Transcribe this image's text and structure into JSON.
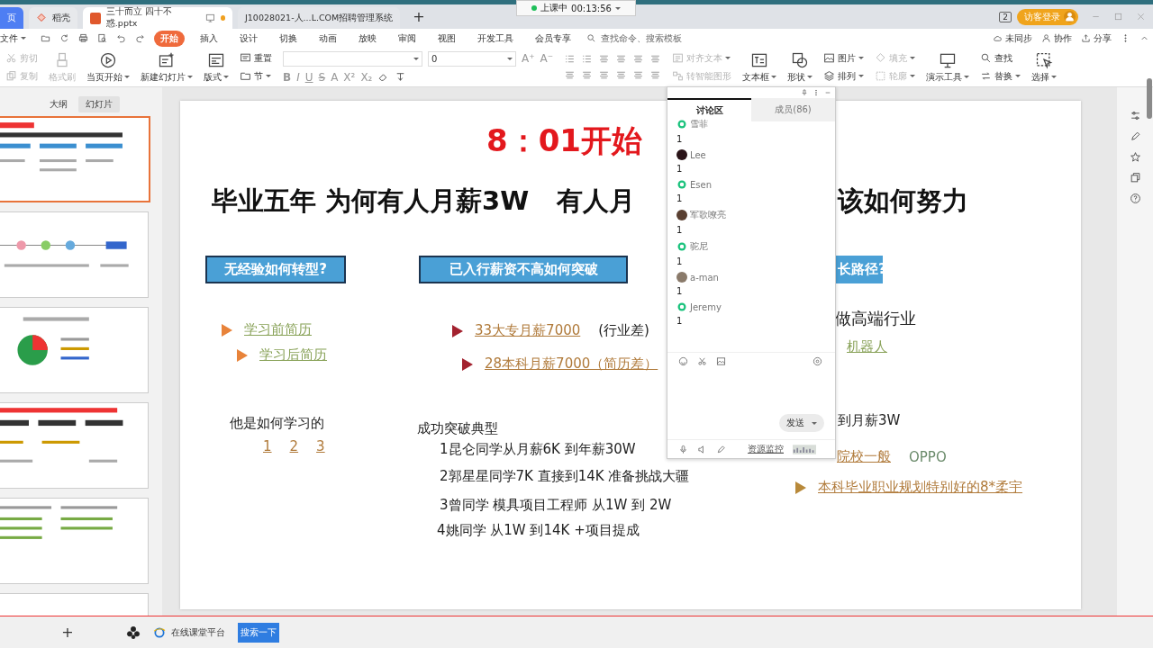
{
  "recording_widget": {
    "status": "上课中",
    "time": "00:13:56"
  },
  "tabs": [
    {
      "label": "页",
      "kind": "home",
      "selected": false
    },
    {
      "label": "稻壳",
      "kind": "docer",
      "selected": false
    },
    {
      "label": "三十而立 四十不惑.pptx",
      "kind": "pptx",
      "selected": true,
      "unsaved": true
    },
    {
      "label": "J10028021-人...L.COM招聘管理系统",
      "kind": "web",
      "selected": false
    }
  ],
  "new_tab": "+",
  "account": {
    "badge": "2",
    "login": "访客登录"
  },
  "menu": {
    "file": "文件",
    "items": [
      {
        "label": "开始",
        "selected": true
      },
      {
        "label": "插入",
        "selected": false
      },
      {
        "label": "设计",
        "selected": false
      },
      {
        "label": "切换",
        "selected": false
      },
      {
        "label": "动画",
        "selected": false
      },
      {
        "label": "放映",
        "selected": false
      },
      {
        "label": "审阅",
        "selected": false
      },
      {
        "label": "视图",
        "selected": false
      },
      {
        "label": "开发工具",
        "selected": false
      },
      {
        "label": "会员专享",
        "selected": false
      }
    ],
    "search": {
      "placeholder": "查找命令、搜索模板"
    },
    "right": [
      "未同步",
      "协作",
      "分享"
    ]
  },
  "ribbon": [
    {
      "kind": "stack",
      "items": [
        {
          "label": "剪切",
          "disabled": true,
          "dropdown": false
        },
        {
          "label": "复制",
          "disabled": true,
          "dropdown": false
        }
      ]
    },
    {
      "kind": "large",
      "label": "格式刷",
      "disabled": true,
      "dropdown": false
    },
    {
      "kind": "large",
      "label": "当页开始",
      "disabled": false,
      "dropdown": true
    },
    {
      "kind": "large",
      "label": "新建幻灯片",
      "disabled": false,
      "dropdown": true
    },
    {
      "kind": "large",
      "label": "版式",
      "disabled": false,
      "dropdown": true
    },
    {
      "kind": "stack",
      "items": [
        {
          "label": "重置",
          "disabled": false,
          "dropdown": false
        },
        {
          "label": "节",
          "disabled": false,
          "dropdown": true
        }
      ]
    },
    {
      "kind": "font",
      "size": "0",
      "row1": [
        "A⁺",
        "A⁻"
      ],
      "row2": [
        "B",
        "I",
        "U",
        "S",
        "A",
        "X²",
        "X₂"
      ]
    },
    {
      "kind": "paragraph"
    },
    {
      "kind": "stack",
      "items": [
        {
          "label": "对齐文本",
          "disabled": true,
          "dropdown": true
        },
        {
          "label": "转智能图形",
          "disabled": true,
          "dropdown": false
        }
      ]
    },
    {
      "kind": "large",
      "label": "文本框",
      "disabled": false,
      "dropdown": true
    },
    {
      "kind": "large",
      "label": "形状",
      "disabled": false,
      "dropdown": true
    },
    {
      "kind": "stack",
      "items": [
        {
          "label": "图片",
          "disabled": false,
          "dropdown": true
        },
        {
          "label": "排列",
          "disabled": false,
          "dropdown": true
        }
      ]
    },
    {
      "kind": "stack",
      "items": [
        {
          "label": "填充",
          "disabled": true,
          "dropdown": true
        },
        {
          "label": "轮廓",
          "disabled": true,
          "dropdown": true
        }
      ]
    },
    {
      "kind": "large",
      "label": "演示工具",
      "disabled": false,
      "dropdown": true
    },
    {
      "kind": "stack",
      "items": [
        {
          "label": "查找",
          "disabled": false,
          "dropdown": false
        },
        {
          "label": "替换",
          "disabled": false,
          "dropdown": true
        }
      ]
    },
    {
      "kind": "large",
      "label": "选择",
      "disabled": false,
      "dropdown": true
    }
  ],
  "side_panel": {
    "tabs": [
      {
        "label": "大纲",
        "selected": false
      },
      {
        "label": "幻灯片",
        "selected": true
      }
    ],
    "thumbnails": [
      {
        "selected": true
      },
      {
        "selected": false
      },
      {
        "selected": false
      },
      {
        "selected": false
      },
      {
        "selected": false
      },
      {
        "selected": false
      }
    ],
    "add": "+"
  },
  "slide": {
    "heading": "8：01开始",
    "title_parts": [
      "毕业五年 为何有人月薪3W   有人月",
      "该如何努力"
    ],
    "boxes": [
      "无经验如何转型?",
      "已入行薪资不高如何突破",
      "长路径?"
    ],
    "lines": [
      {
        "bullet": {
          "color": "#e8833a"
        },
        "spans": [
          {
            "kind": "link",
            "text": "学习前简历",
            "color": "#8aa35a"
          }
        ]
      },
      {
        "bullet": {
          "color": "#e8833a"
        },
        "spans": [
          {
            "kind": "link",
            "text": "学习后简历",
            "color": "#8aa35a"
          }
        ]
      },
      {
        "spans": [
          {
            "kind": "text",
            "text": "他是如何学习的"
          }
        ]
      },
      {
        "spans": [
          {
            "kind": "link",
            "text": "1",
            "color": "#b07a3a"
          },
          {
            "kind": "link",
            "text": "2",
            "color": "#b07a3a"
          },
          {
            "kind": "link",
            "text": "3",
            "color": "#b07a3a"
          }
        ]
      },
      {
        "bullet": {
          "color": "#a3222f"
        },
        "spans": [
          {
            "kind": "link",
            "text": "33大专月薪7000",
            "color": "#b07a3a"
          },
          {
            "kind": "text",
            "text": "(行业差)"
          }
        ]
      },
      {
        "bullet": {
          "color": "#a3222f"
        },
        "spans": [
          {
            "kind": "link",
            "text": "28本科月薪7000（简历差）",
            "color": "#b07a3a"
          }
        ]
      },
      {
        "spans": [
          {
            "kind": "text",
            "text": "成功突破典型"
          }
        ]
      },
      {
        "spans": [
          {
            "kind": "text",
            "text": "1昆仑同学从月薪6K  到年薪30W"
          }
        ]
      },
      {
        "spans": [
          {
            "kind": "text",
            "text": "2郭星星同学7K 直接到14K 准备挑战大疆"
          }
        ]
      },
      {
        "spans": [
          {
            "kind": "text",
            "text": "3曾同学 模具项目工程师  从1W 到 2W"
          }
        ]
      },
      {
        "spans": [
          {
            "kind": "text",
            "text": "4姚同学 从1W 到14K +项目提成"
          }
        ]
      },
      {
        "spans": [
          {
            "kind": "text",
            "text": "做高端行业"
          }
        ]
      },
      {
        "spans": [
          {
            "kind": "link",
            "text": "机器人",
            "color": "#8aa35a"
          }
        ]
      },
      {
        "spans": [
          {
            "kind": "text",
            "text": "到月薪3W"
          }
        ]
      },
      {
        "spans": [
          {
            "kind": "link",
            "text": "院校一般",
            "color": "#b07a3a"
          },
          {
            "kind": "text",
            "text": "OPPO",
            "color": "#6a8a6a"
          }
        ]
      },
      {
        "bullet": {
          "color": "#b8893a"
        },
        "spans": [
          {
            "kind": "link",
            "text": "本科毕业职业规划特别好的8*柔宇",
            "color": "#b07a3a"
          }
        ]
      }
    ]
  },
  "chat": {
    "tabs": [
      {
        "label": "讨论区",
        "selected": true
      },
      {
        "label": "成员(86)",
        "selected": false
      }
    ],
    "messages": [
      {
        "name": "雪菲",
        "kind": "default",
        "text": "1"
      },
      {
        "name": "Lee",
        "kind": "photo",
        "text": "1"
      },
      {
        "name": "Esen",
        "kind": "default",
        "text": "1"
      },
      {
        "name": "军歌嘹亮",
        "kind": "photo",
        "text": "1"
      },
      {
        "name": "驼尼",
        "kind": "default",
        "text": "1"
      },
      {
        "name": "a-man",
        "kind": "photo",
        "text": "1"
      },
      {
        "name": "Jeremy",
        "kind": "default",
        "text": "1"
      }
    ],
    "send": "发送",
    "monitor": "资源监控"
  },
  "taskbar": {
    "app": "在线课堂平台",
    "search": "搜索一下"
  }
}
